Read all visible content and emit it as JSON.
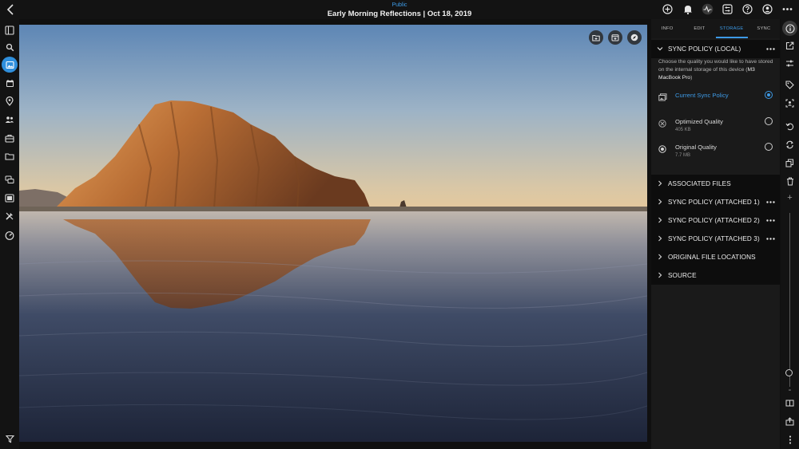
{
  "header": {
    "visibility": "Public",
    "title": "Early Morning Reflections | Oct 18, 2019",
    "back_icon": "chevron-left-icon",
    "right_icons": [
      "add-circle-icon",
      "bell-icon",
      "activity-icon",
      "tune-icon",
      "help-icon",
      "account-icon",
      "more-icon"
    ]
  },
  "left_sidebar": {
    "items": [
      "sidebar-toggle-icon",
      "search-icon",
      "photos-icon",
      "calendar-icon",
      "map-pin-icon",
      "people-icon",
      "briefcase-icon",
      "folder-icon",
      "stack-icon",
      "album-icon",
      "tools-icon",
      "speedometer-icon",
      "filter-icon"
    ],
    "active": "photos-icon"
  },
  "photo": {
    "overlay_icons": [
      "add-to-folder-icon",
      "add-to-calendar-icon",
      "compass-icon"
    ]
  },
  "info_panel": {
    "tabs": [
      "INFO",
      "EDIT",
      "STORAGE",
      "SYNC"
    ],
    "active_tab": "STORAGE",
    "sync_local": {
      "label": "SYNC POLICY (LOCAL)",
      "description": "Choose the quality you would like to have stored on the internal storage of this device (",
      "device": "M3 MacBook Pro",
      "description_end": ")"
    },
    "options": [
      {
        "name": "Current Sync Policy",
        "size": "",
        "icon": "image-stack-icon",
        "selected": true
      },
      {
        "name": "Optimized Quality",
        "size": "405 KB",
        "icon": "optimized-icon",
        "selected": false
      },
      {
        "name": "Original Quality",
        "size": "7.7 MB",
        "icon": "original-icon",
        "selected": false
      }
    ],
    "sections": [
      {
        "label": "ASSOCIATED FILES",
        "has_menu": false
      },
      {
        "label": "SYNC POLICY (ATTACHED 1)",
        "has_menu": true
      },
      {
        "label": "SYNC POLICY (ATTACHED 2)",
        "has_menu": true
      },
      {
        "label": "SYNC POLICY (ATTACHED 3)",
        "has_menu": true
      },
      {
        "label": "ORIGINAL FILE LOCATIONS",
        "has_menu": false
      },
      {
        "label": "SOURCE",
        "has_menu": false
      }
    ]
  },
  "right_bar": {
    "icons": [
      "info-icon",
      "open-external-icon",
      "adjustments-icon",
      "tag-icon",
      "face-recognition-icon",
      "rotate-icon",
      "sync-icon",
      "copy-icon",
      "trash-icon"
    ],
    "active": "info-icon",
    "zoom_plus": "+",
    "zoom_minus": "-",
    "bottom_icons": [
      "compare-icon",
      "share-icon",
      "more-vertical-icon"
    ]
  },
  "colors": {
    "accent": "#3d9ae6",
    "background": "#101010",
    "panel": "#1a1a1a",
    "section": "#0d0d0d"
  }
}
